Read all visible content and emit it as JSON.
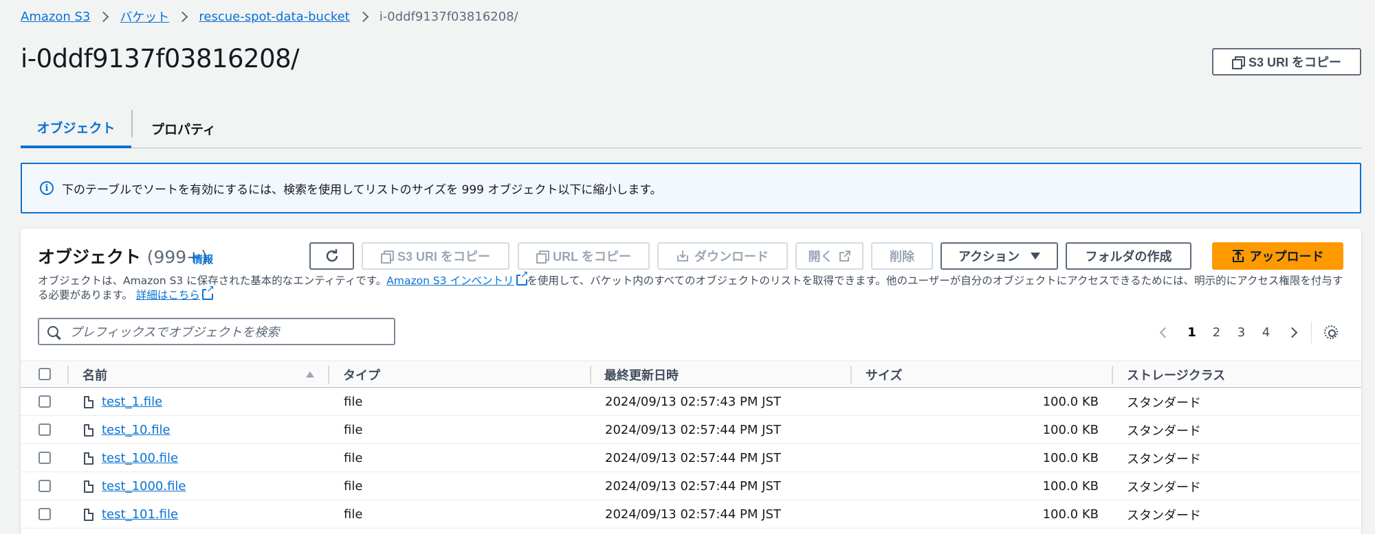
{
  "breadcrumb": {
    "items": [
      "Amazon S3",
      "バケット",
      "rescue-spot-data-bucket"
    ],
    "current": "i-0ddf9137f03816208/"
  },
  "page": {
    "title": "i-0ddf9137f03816208/",
    "copy_uri_label": "S3 URI をコピー"
  },
  "tabs": [
    {
      "label": "オブジェクト",
      "active": true
    },
    {
      "label": "プロパティ",
      "active": false
    }
  ],
  "alert": {
    "icon": "info-icon",
    "text": "下のテーブルでソートを有効にするには、検索を使用してリストのサイズを 999 オブジェクト以下に縮小します。"
  },
  "objects": {
    "title": "オブジェクト",
    "count": "(999+)",
    "info_label": "情報",
    "desc_part1": "オブジェクトは、Amazon S3 に保存された基本的なエンティティです。",
    "desc_link1": "Amazon S3 インベントリ",
    "desc_part2": "を使用して、バケット内のすべてのオブジェクトのリストを取得できます。他のユーザーが自分のオブジェクトにアクセスできるためには、明示的にアクセス権限を付与する必要があります。",
    "desc_link2": "詳細はこちら",
    "toolbar": {
      "copy_s3_uri": "S3 URI をコピー",
      "copy_url": "URL をコピー",
      "download": "ダウンロード",
      "open": "開く",
      "delete": "削除",
      "actions": "アクション",
      "create_folder": "フォルダの作成",
      "upload": "アップロード"
    },
    "search_placeholder": "プレフィックスでオブジェクトを検索",
    "pagination": {
      "pages": [
        "1",
        "2",
        "3",
        "4"
      ],
      "current": "1"
    },
    "columns": [
      "名前",
      "タイプ",
      "最終更新日時",
      "サイズ",
      "ストレージクラス"
    ],
    "rows": [
      {
        "name": "test_1.file",
        "type": "file",
        "modified": "2024/09/13 02:57:43 PM JST",
        "size": "100.0 KB",
        "storage": "スタンダード"
      },
      {
        "name": "test_10.file",
        "type": "file",
        "modified": "2024/09/13 02:57:44 PM JST",
        "size": "100.0 KB",
        "storage": "スタンダード"
      },
      {
        "name": "test_100.file",
        "type": "file",
        "modified": "2024/09/13 02:57:44 PM JST",
        "size": "100.0 KB",
        "storage": "スタンダード"
      },
      {
        "name": "test_1000.file",
        "type": "file",
        "modified": "2024/09/13 02:57:44 PM JST",
        "size": "100.0 KB",
        "storage": "スタンダード"
      },
      {
        "name": "test_101.file",
        "type": "file",
        "modified": "2024/09/13 02:57:44 PM JST",
        "size": "100.0 KB",
        "storage": "スタンダード"
      }
    ]
  },
  "colors": {
    "accent": "#0972d3",
    "primary_button": "#ff9900",
    "background": "#f2f3f3"
  }
}
